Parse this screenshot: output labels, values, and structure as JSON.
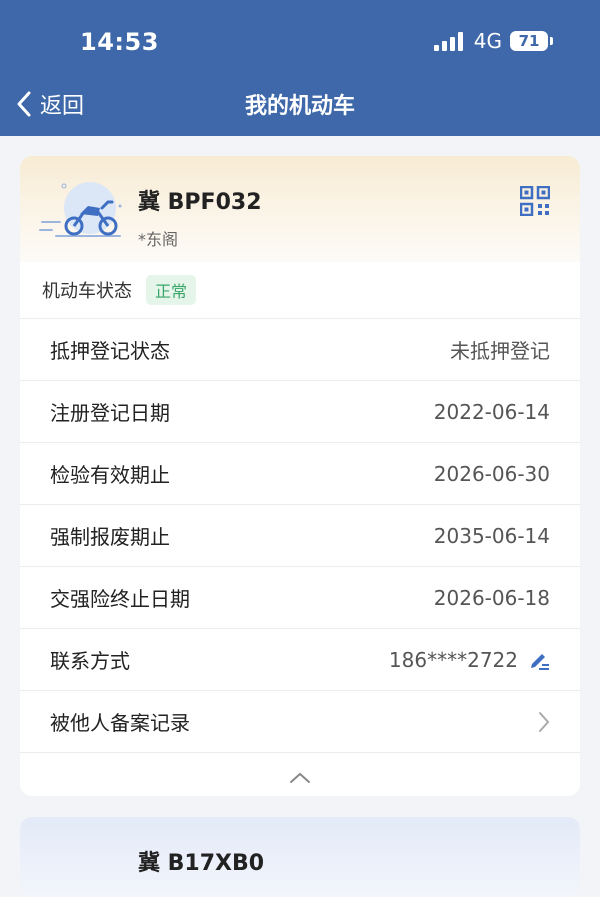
{
  "status_bar": {
    "time": "14:53",
    "network": "4G",
    "battery": "71"
  },
  "nav": {
    "back_label": "返回",
    "title": "我的机动车"
  },
  "vehicle": {
    "plate": "冀 BPF032",
    "owner": "*东阁",
    "status_label": "机动车状态",
    "status_value": "正常",
    "status_color": "#3aa56a",
    "details": [
      {
        "label": "抵押登记状态",
        "value": "未抵押登记"
      },
      {
        "label": "注册登记日期",
        "value": "2022-06-14"
      },
      {
        "label": "检验有效期止",
        "value": "2026-06-30"
      },
      {
        "label": "强制报废期止",
        "value": "2035-06-14"
      },
      {
        "label": "交强险终止日期",
        "value": "2026-06-18"
      }
    ],
    "contact_label": "联系方式",
    "contact_value": "186****2722",
    "filing_label": "被他人备案记录"
  },
  "vehicle2": {
    "plate": "冀 B17XB0"
  },
  "colors": {
    "header": "#3e68a9",
    "accent": "#3f6fc2"
  },
  "icons": [
    "back-chevron-icon",
    "qr-code-icon",
    "motorcycle-icon",
    "edit-icon",
    "chevron-right-icon",
    "chevron-up-icon"
  ]
}
